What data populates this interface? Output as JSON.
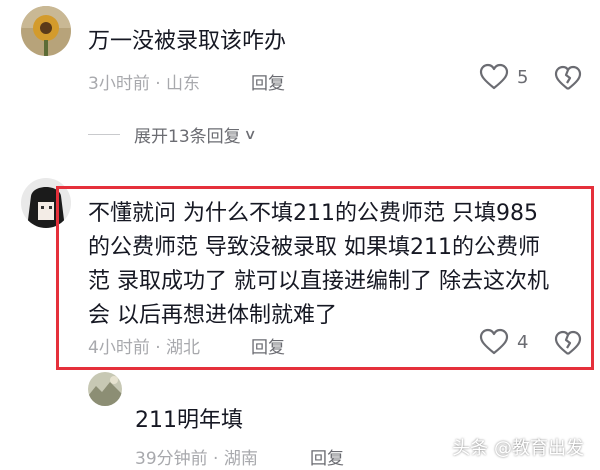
{
  "comments": [
    {
      "text": "万一没被录取该咋办",
      "meta": "3小时前 · 山东",
      "reply_label": "回复",
      "likes": "5"
    },
    {
      "lines": [
        "不懂就问 为什么不填211的公费师范 只填985",
        "的公费师范 导致没被录取 如果填211的公费师",
        "范 录取成功了 就可以直接进编制了 除去这次机",
        "会 以后再想进体制就难了"
      ],
      "meta": "4小时前 · 湖北",
      "reply_label": "回复",
      "likes": "4"
    },
    {
      "text": "211明年填",
      "meta": "39分钟前 · 湖南",
      "reply_label": "回复"
    }
  ],
  "expand_replies": {
    "label": "展开13条回复"
  },
  "watermark": "头条 @教育出发",
  "colors": {
    "highlight": "#e5303b",
    "meta": "#a8a9ad",
    "text": "#161823"
  }
}
